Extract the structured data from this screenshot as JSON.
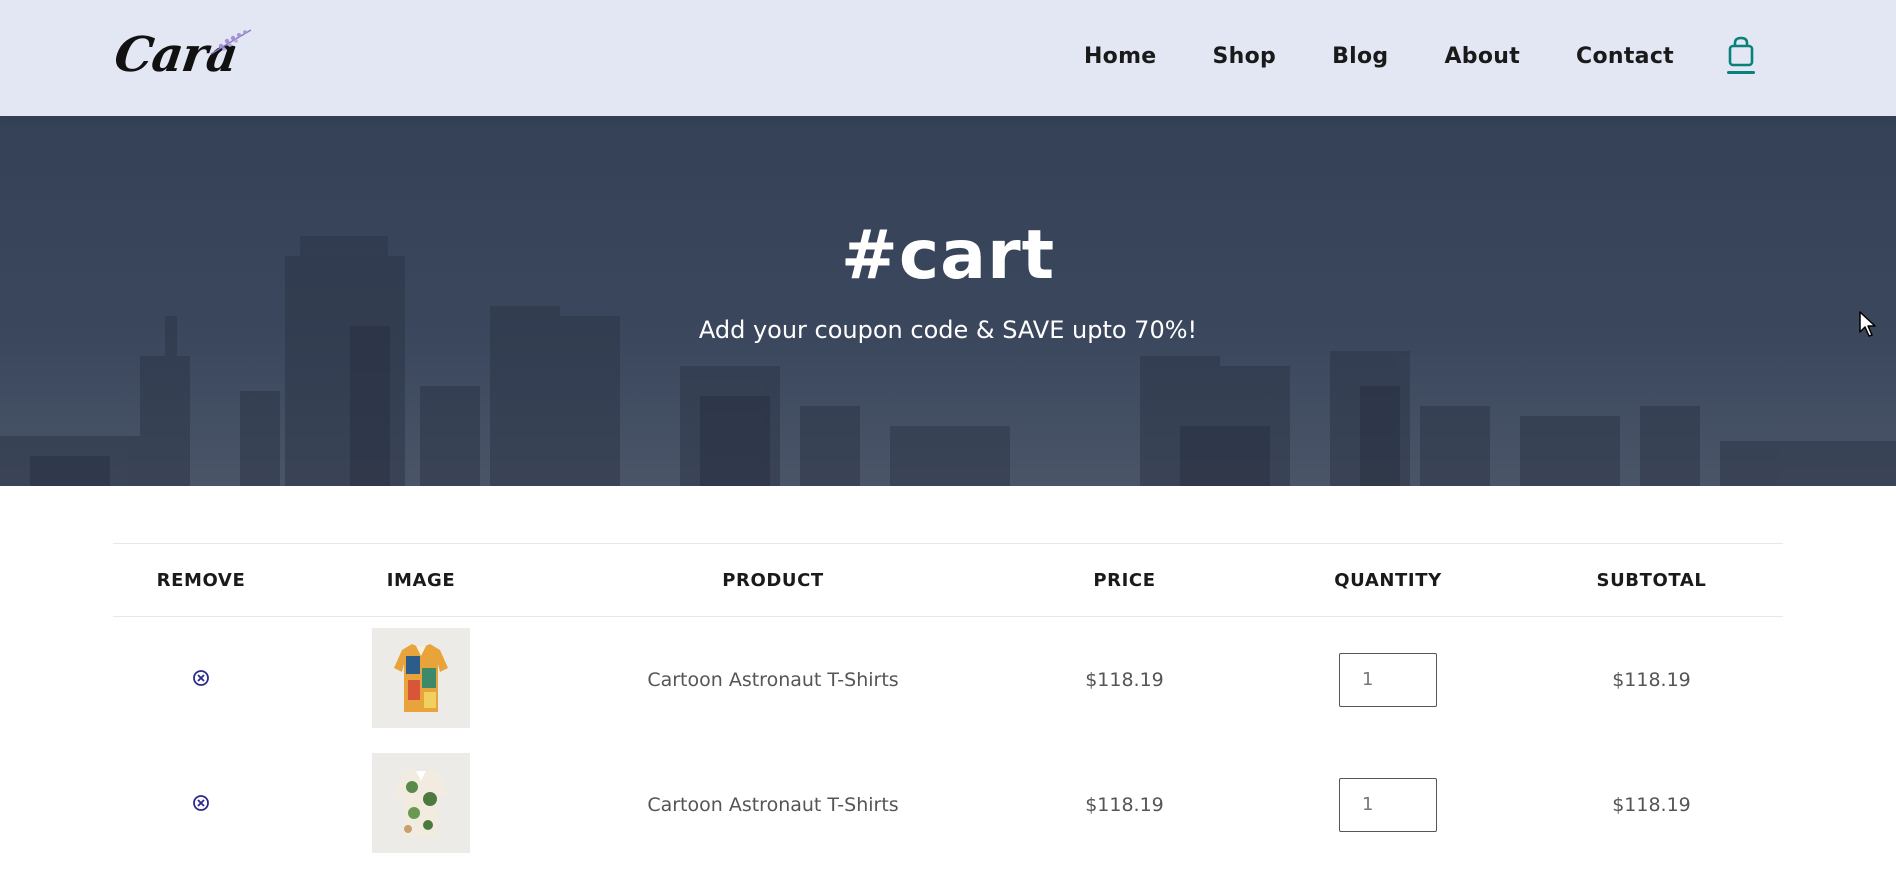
{
  "header": {
    "logo_text": "Cara",
    "nav": {
      "home": "Home",
      "shop": "Shop",
      "blog": "Blog",
      "about": "About",
      "contact": "Contact"
    },
    "cart_icon": "shopping-bag-icon",
    "accent_color": "#088178"
  },
  "hero": {
    "title": "#cart",
    "subtitle": "Add your coupon code & SAVE upto 70%!"
  },
  "cart": {
    "columns": {
      "remove": "REMOVE",
      "image": "IMAGE",
      "product": "PRODUCT",
      "price": "PRICE",
      "quantity": "QUANTITY",
      "subtotal": "SUBTOTAL"
    },
    "remove_icon": "circle-x-icon",
    "items": [
      {
        "product": "Cartoon Astronaut T-Shirts",
        "price": "$118.19",
        "quantity": "1",
        "subtotal": "$118.19"
      },
      {
        "product": "Cartoon Astronaut T-Shirts",
        "price": "$118.19",
        "quantity": "1",
        "subtotal": "$118.19"
      }
    ]
  }
}
